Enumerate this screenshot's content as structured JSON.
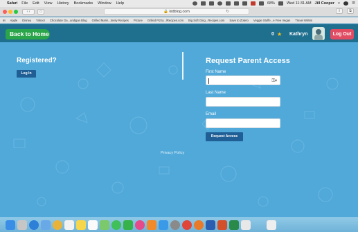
{
  "menubar": {
    "app": "Safari",
    "items": [
      "File",
      "Edit",
      "View",
      "History",
      "Bookmarks",
      "Window",
      "Help"
    ],
    "battery": "68%",
    "datetime": "Wed 11:31 AM",
    "user": "Jill Cooper"
  },
  "browser": {
    "url": "kidblog.com"
  },
  "bookmarks": [
    "Apple",
    "Disney",
    "Yahoo!",
    "Chocolate Ga...andigan Blog",
    "Grilled Marin...tinely Recipes",
    "Picture",
    "Grilled Pizza...lRecipes.com",
    "Big Soft Ging...Recipes.com",
    "Save to Zotero",
    "Veggie Stuffe...e Free Vegan",
    "Travel WiWin"
  ],
  "header": {
    "back_label": "Back to Home",
    "score": "0",
    "username": "Kathryn",
    "logout_label": "Log Out"
  },
  "registered": {
    "title": "Registered?",
    "login_label": "Log In"
  },
  "request": {
    "title": "Request Parent Access",
    "first_name_label": "First Name",
    "last_name_label": "Last Name",
    "email_label": "Email",
    "submit_label": "Request Access"
  },
  "footer": {
    "privacy_label": "Privacy Policy"
  },
  "colors": {
    "header_bg": "#1f6f8f",
    "page_bg": "#50a9d9",
    "back_button": "#2aa54a",
    "logout_button": "#e24c63",
    "action_button": "#1f5f95"
  },
  "dock_icons": [
    "finder-icon",
    "launchpad-icon",
    "safari-icon",
    "mail-icon",
    "photos-icon",
    "calendar-icon",
    "notes-icon",
    "reminders-icon",
    "maps-icon",
    "messages-icon",
    "facetime-icon",
    "itunes-icon",
    "ibooks-icon",
    "app-store-icon",
    "system-preferences-icon",
    "chrome-icon",
    "firefox-icon",
    "word-icon",
    "powerpoint-icon",
    "excel-icon",
    "preview-icon",
    "trash-icon"
  ]
}
